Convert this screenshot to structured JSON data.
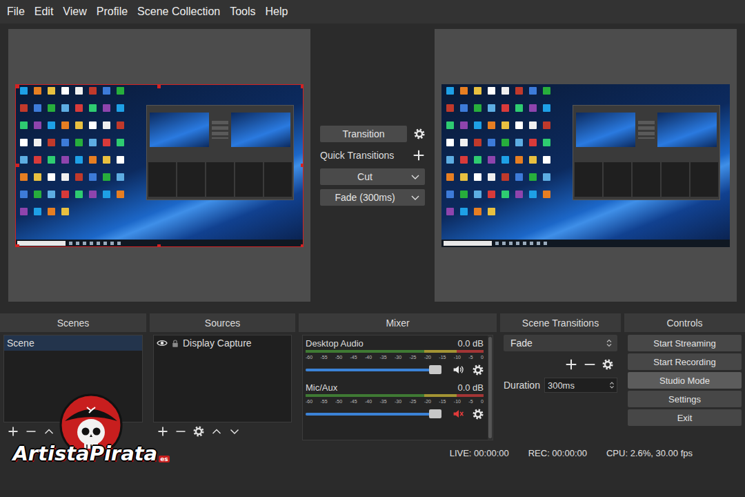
{
  "menu": [
    "File",
    "Edit",
    "View",
    "Profile",
    "Scene Collection",
    "Tools",
    "Help"
  ],
  "previews": [
    {
      "name": "preview",
      "source_selected": true
    },
    {
      "name": "program",
      "source_selected": false
    }
  ],
  "transition_panel": {
    "button": "Transition",
    "quick_label": "Quick Transitions",
    "quick": [
      "Cut",
      "Fade (300ms)"
    ]
  },
  "docks": {
    "scenes": "Scenes",
    "sources": "Sources",
    "mixer": "Mixer",
    "scene_transitions": "Scene Transitions",
    "controls": "Controls"
  },
  "scenes": [
    {
      "label": "Scene",
      "selected": true
    }
  ],
  "sources": [
    {
      "label": "Display Capture",
      "visible": true,
      "locked": false
    }
  ],
  "mixer": {
    "scale": [
      "-60",
      "-55",
      "-50",
      "-45",
      "-40",
      "-35",
      "-30",
      "-25",
      "-20",
      "-15",
      "-10",
      "-5",
      "0"
    ],
    "channels": [
      {
        "name": "Desktop Audio",
        "reading": "0.0 dB",
        "level": 1,
        "meter_level": 0,
        "muted": false
      },
      {
        "name": "Mic/Aux",
        "reading": "0.0 dB",
        "level": 1,
        "meter_level": 0,
        "muted": true
      }
    ]
  },
  "scene_transitions": {
    "transition": "Fade",
    "duration_label": "Duration",
    "duration": "300ms"
  },
  "controls": [
    {
      "label": "Start Streaming",
      "selected": false
    },
    {
      "label": "Start Recording",
      "selected": false
    },
    {
      "label": "Studio Mode",
      "selected": true
    },
    {
      "label": "Settings",
      "selected": false
    },
    {
      "label": "Exit",
      "selected": false
    }
  ],
  "status_bar": {
    "live": "LIVE: 00:00:00",
    "rec": "REC: 00:00:00",
    "cpu": "CPU: 2.6%, 30.00 fps"
  },
  "watermark": {
    "text": "ArtistaPirata",
    "suffix": "es"
  }
}
